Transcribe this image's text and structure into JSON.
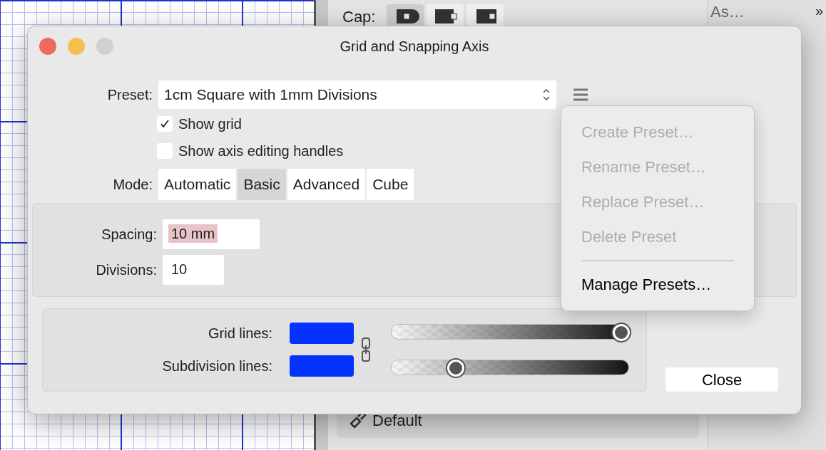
{
  "background": {
    "cap_label": "Cap:",
    "cap_buttons": [
      {
        "selected": true
      },
      {
        "selected": false
      },
      {
        "selected": false
      }
    ],
    "side_label": "As…",
    "overflow": "»",
    "style_dropdown": "Default"
  },
  "window": {
    "title": "Grid and Snapping Axis"
  },
  "preset": {
    "label": "Preset:",
    "value": "1cm Square with 1mm Divisions"
  },
  "checkboxes": [
    {
      "label": "Show grid",
      "checked": true
    },
    {
      "label": "Show axis editing handles",
      "checked": false
    }
  ],
  "mode": {
    "label": "Mode:",
    "options": [
      {
        "label": "Automatic",
        "selected": false
      },
      {
        "label": "Basic",
        "selected": true
      },
      {
        "label": "Advanced",
        "selected": false
      },
      {
        "label": "Cube",
        "selected": false
      }
    ]
  },
  "fields": [
    {
      "label": "Spacing:",
      "value": "10 mm",
      "highlighted": true
    },
    {
      "label": "Divisions:",
      "value": "10",
      "highlighted": false
    }
  ],
  "lines": [
    {
      "label": "Grid lines:",
      "color": "#0433ff",
      "level": 0.97
    },
    {
      "label": "Subdivision lines:",
      "color": "#0433ff",
      "level": 0.27
    }
  ],
  "close_button": "Close",
  "preset_menu": [
    {
      "label": "Create Preset…",
      "disabled": true
    },
    {
      "label": "Rename Preset…",
      "disabled": true
    },
    {
      "label": "Replace Preset…",
      "disabled": true
    },
    {
      "label": "Delete Preset",
      "disabled": true,
      "separator_after": true
    },
    {
      "label": "Manage Presets…",
      "disabled": false
    }
  ]
}
